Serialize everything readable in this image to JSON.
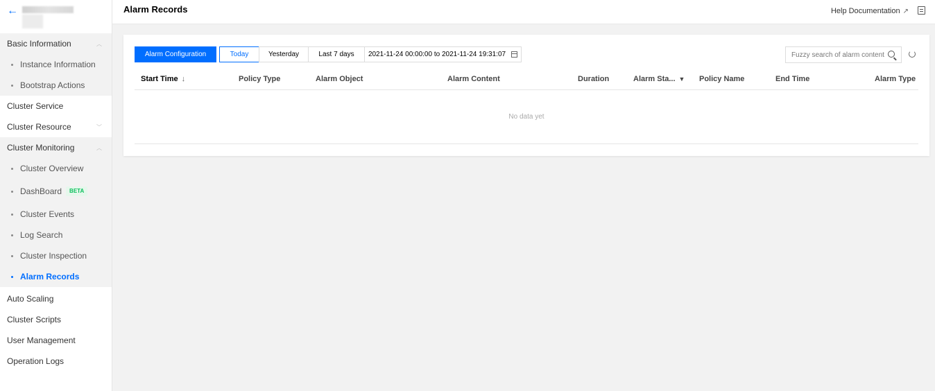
{
  "header": {
    "title": "Alarm Records",
    "help_label": "Help Documentation"
  },
  "sidebar": {
    "items": [
      {
        "label": "Basic Information",
        "expanded": true,
        "children": [
          "Instance Information",
          "Bootstrap Actions"
        ]
      },
      {
        "label": "Cluster Service"
      },
      {
        "label": "Cluster Resource",
        "expanded": false
      },
      {
        "label": "Cluster Monitoring",
        "expanded": true,
        "children": [
          "Cluster Overview",
          "DashBoard",
          "Cluster Events",
          "Log Search",
          "Cluster Inspection",
          "Alarm Records"
        ]
      },
      {
        "label": "Auto Scaling"
      },
      {
        "label": "Cluster Scripts"
      },
      {
        "label": "User Management"
      },
      {
        "label": "Operation Logs"
      }
    ],
    "beta_badge": "BETA",
    "active_item": "Alarm Records"
  },
  "toolbar": {
    "alarm_config_label": "Alarm Configuration",
    "today_label": "Today",
    "yesterday_label": "Yesterday",
    "last7_label": "Last 7 days",
    "date_range": "2021-11-24 00:00:00 to 2021-11-24 19:31:07",
    "search_placeholder": "Fuzzy search of alarm content",
    "selected_range": "Today"
  },
  "table": {
    "columns": [
      "Start Time",
      "Policy Type",
      "Alarm Object",
      "Alarm Content",
      "Duration",
      "Alarm Sta...",
      "Policy Name",
      "End Time",
      "Alarm Type"
    ],
    "rows": [],
    "empty_text": "No data yet"
  },
  "colors": {
    "accent": "#006eff",
    "beta_bg": "#e6f7ec",
    "beta_text": "#0abf5b"
  }
}
